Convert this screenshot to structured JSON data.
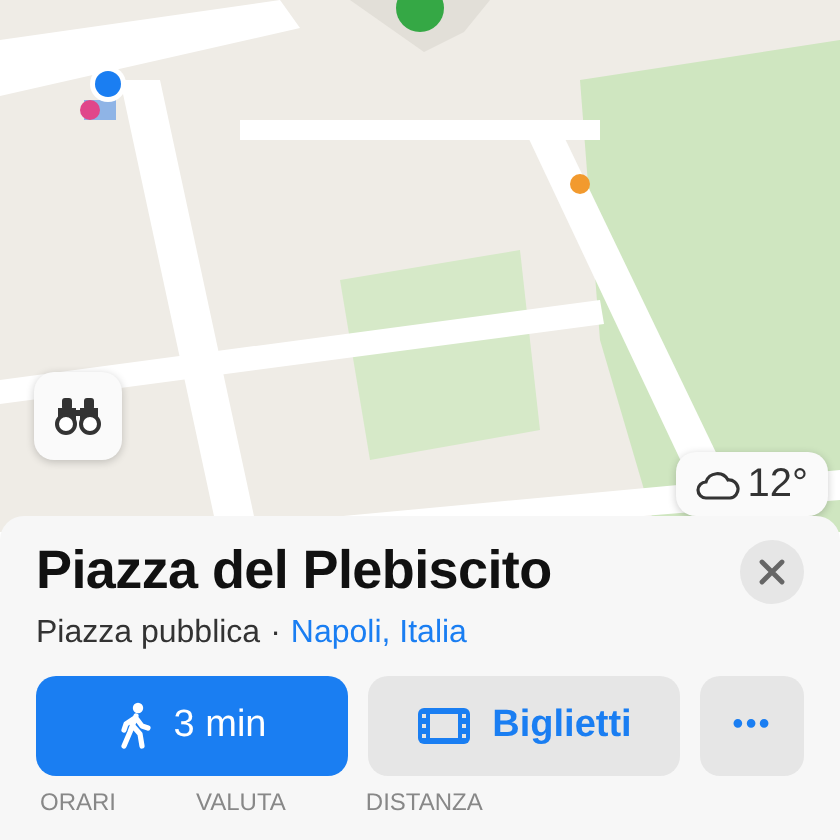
{
  "map": {
    "kind": "picture",
    "weather": {
      "temperature": "12°"
    }
  },
  "place": {
    "title": "Piazza del Plebiscito",
    "category": "Piazza pubblica",
    "separator": "·",
    "location": "Napoli, Italia"
  },
  "actions": [
    {
      "kind": "primary",
      "label": "3 min"
    },
    {
      "kind": "secondary",
      "label": "Biglietti"
    },
    {
      "kind": "more",
      "label": "•••"
    }
  ],
  "info_headers": [
    "ORARI",
    "VALUTA",
    "DISTANZA"
  ]
}
